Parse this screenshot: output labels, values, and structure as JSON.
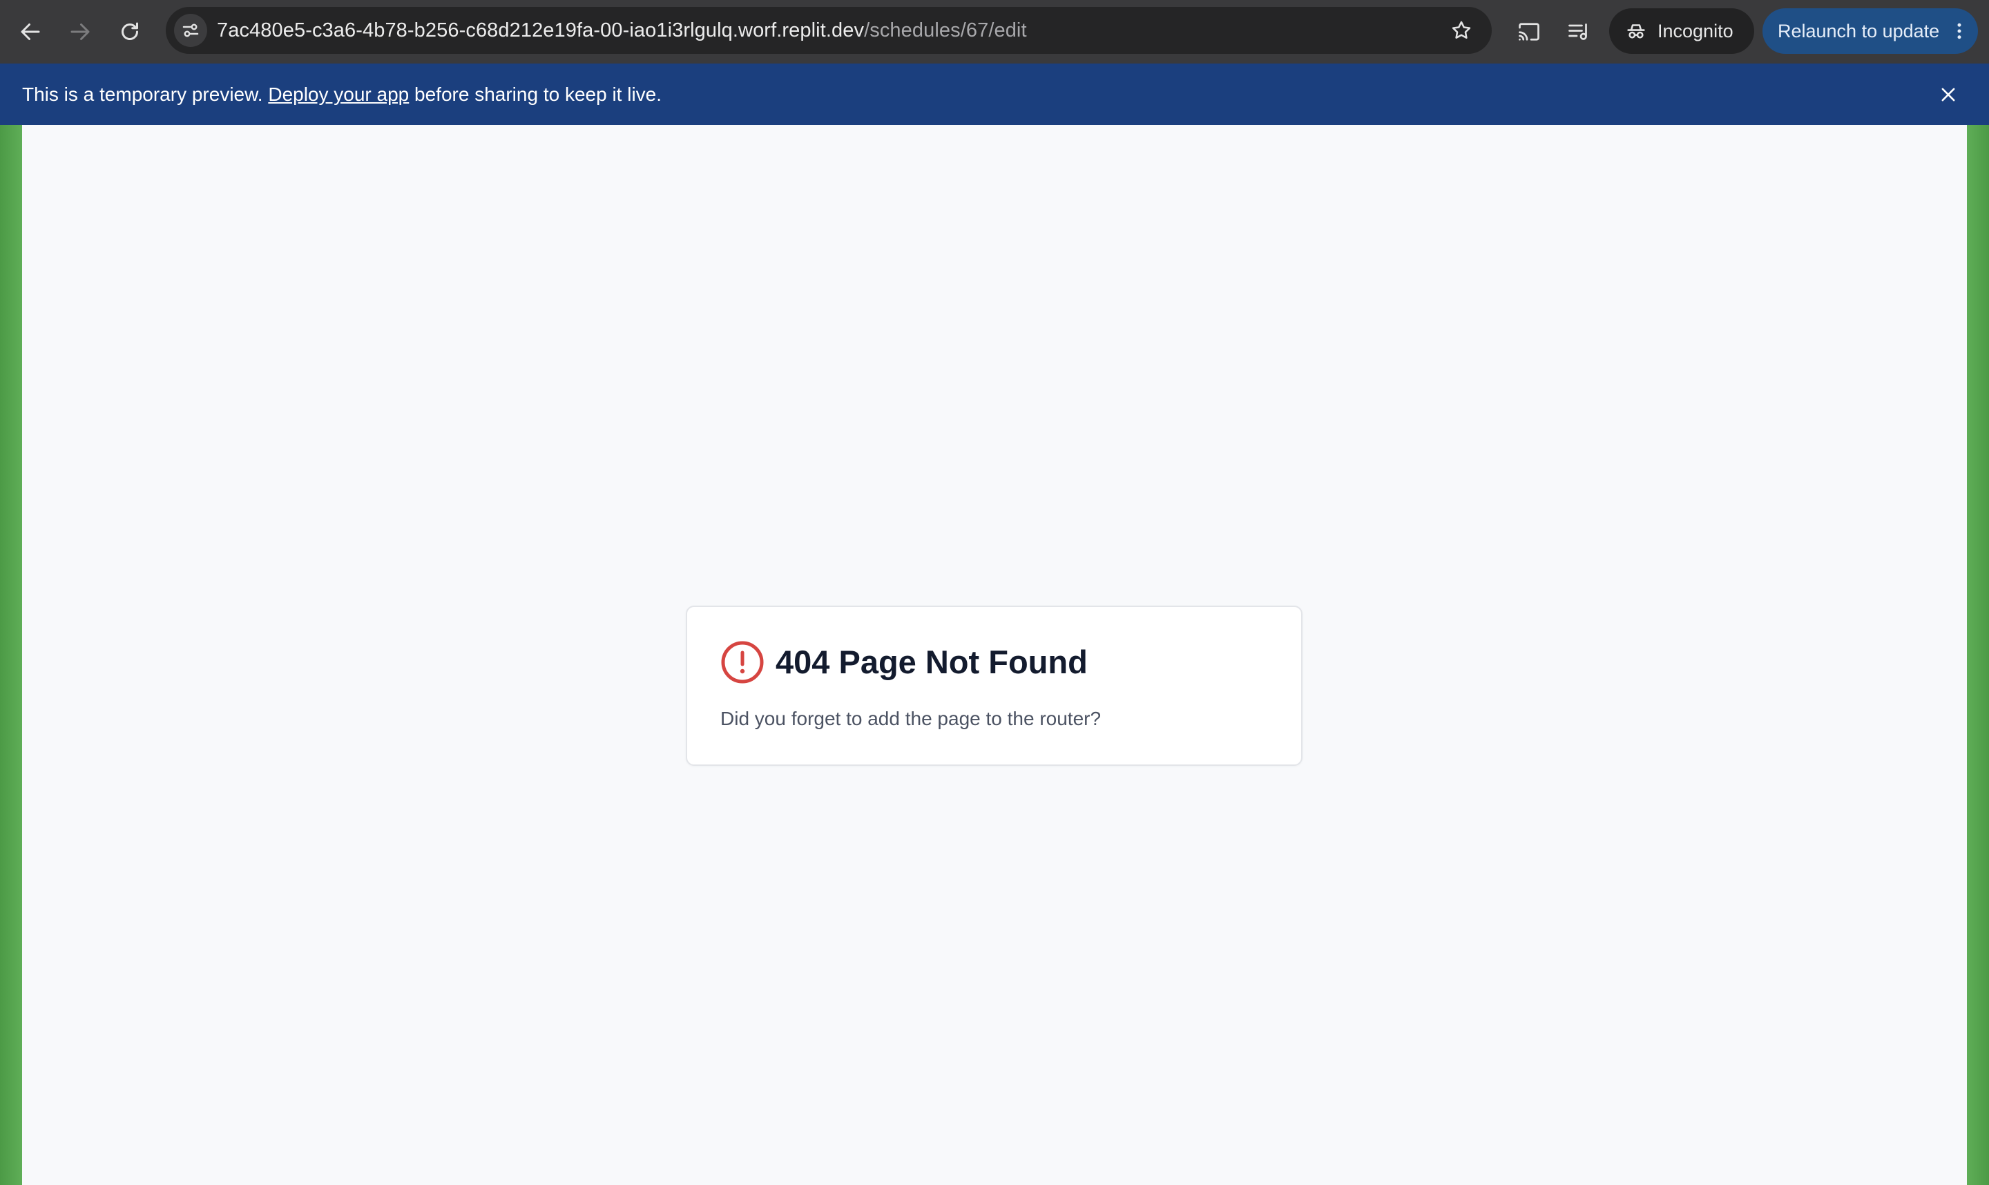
{
  "browser": {
    "url_host": "7ac480e5-c3a6-4b78-b256-c68d212e19fa-00-iao1i3rlgulq.worf.replit.dev",
    "url_path": "/schedules/67/edit",
    "incognito_label": "Incognito",
    "relaunch_label": "Relaunch to update",
    "icons": [
      "back-arrow-icon",
      "forward-arrow-icon",
      "reload-icon",
      "site-settings-icon",
      "star-icon",
      "cast-icon",
      "media-queue-icon",
      "incognito-icon",
      "kebab-menu-icon"
    ]
  },
  "banner": {
    "text_before": "This is a temporary preview. ",
    "link": "Deploy your app",
    "text_after": " before sharing to keep it live.",
    "close_icon": "close-icon",
    "color": "#1b3f7e"
  },
  "error_card": {
    "title": "404 Page Not Found",
    "description": "Did you forget to add the page to the router?",
    "icon": "alert-circle-icon",
    "icon_color": "#d64541"
  }
}
